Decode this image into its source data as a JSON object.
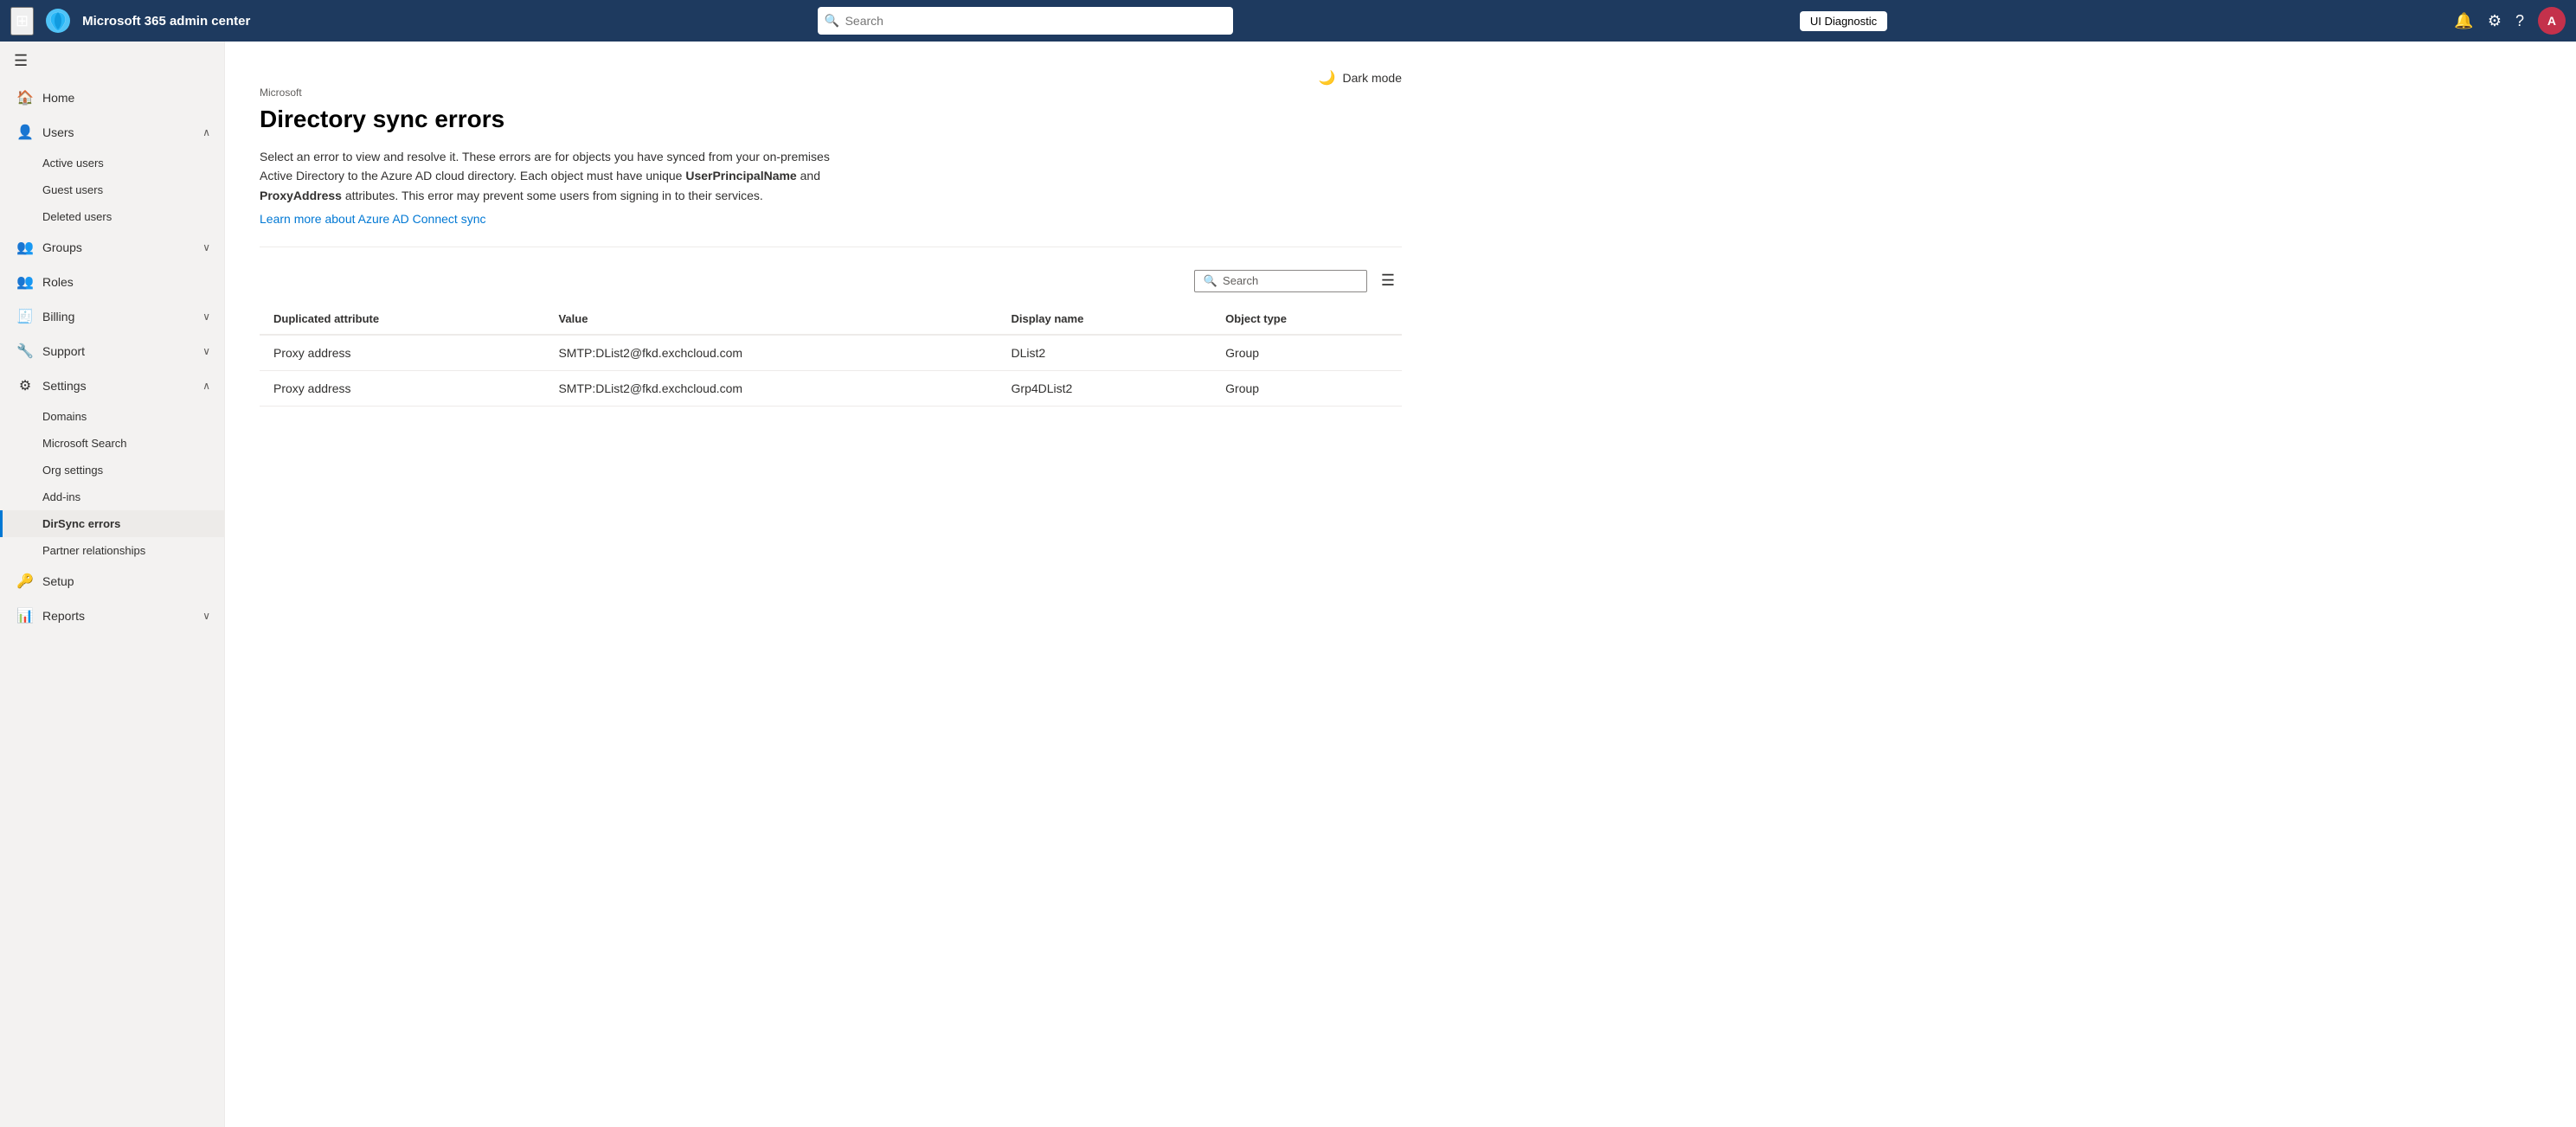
{
  "app": {
    "title": "Microsoft 365 admin center",
    "breadcrumb": "Microsoft",
    "page_title": "Directory sync errors",
    "description_part1": "Select an error to view and resolve it. These errors are for objects you have synced from your on-premises Active Directory to the Azure AD cloud directory. Each object must have unique ",
    "description_bold1": "UserPrincipalName",
    "description_part2": " and ",
    "description_bold2": "ProxyAddress",
    "description_part3": " attributes. This error may prevent some users from signing in to their services.",
    "learn_more_text": "Learn more about Azure AD Connect sync",
    "dark_mode_label": "Dark mode"
  },
  "topnav": {
    "search_placeholder": "Search",
    "ui_diagnostic_label": "UI Diagnostic",
    "avatar_initials": "A",
    "waffle_icon": "⊞",
    "bell_icon": "🔔",
    "gear_icon": "⚙",
    "help_icon": "?"
  },
  "sidebar": {
    "toggle_icon": "☰",
    "items": [
      {
        "id": "home",
        "label": "Home",
        "icon": "🏠",
        "has_children": false
      },
      {
        "id": "users",
        "label": "Users",
        "icon": "👤",
        "has_children": true,
        "expanded": true
      },
      {
        "id": "groups",
        "label": "Groups",
        "icon": "👥",
        "has_children": true,
        "expanded": false
      },
      {
        "id": "roles",
        "label": "Roles",
        "icon": "🔒",
        "has_children": false
      },
      {
        "id": "billing",
        "label": "Billing",
        "icon": "🧾",
        "has_children": true,
        "expanded": false
      },
      {
        "id": "support",
        "label": "Support",
        "icon": "🔧",
        "has_children": true,
        "expanded": false
      },
      {
        "id": "settings",
        "label": "Settings",
        "icon": "⚙",
        "has_children": true,
        "expanded": true
      },
      {
        "id": "setup",
        "label": "Setup",
        "icon": "🔑",
        "has_children": false
      },
      {
        "id": "reports",
        "label": "Reports",
        "icon": "📊",
        "has_children": true,
        "expanded": false
      }
    ],
    "users_children": [
      {
        "id": "active-users",
        "label": "Active users"
      },
      {
        "id": "guest-users",
        "label": "Guest users"
      },
      {
        "id": "deleted-users",
        "label": "Deleted users"
      }
    ],
    "settings_children": [
      {
        "id": "domains",
        "label": "Domains"
      },
      {
        "id": "microsoft-search",
        "label": "Microsoft Search"
      },
      {
        "id": "org-settings",
        "label": "Org settings"
      },
      {
        "id": "add-ins",
        "label": "Add-ins"
      },
      {
        "id": "dirsync-errors",
        "label": "DirSync errors",
        "active": true
      },
      {
        "id": "partner-relationships",
        "label": "Partner relationships"
      }
    ]
  },
  "table": {
    "search_placeholder": "Search",
    "columns": [
      "Duplicated attribute",
      "Value",
      "Display name",
      "Object type"
    ],
    "rows": [
      {
        "duplicated_attribute": "Proxy address",
        "value": "SMTP:DList2@fkd.exchcloud.com",
        "display_name": "DList2",
        "object_type": "Group"
      },
      {
        "duplicated_attribute": "Proxy address",
        "value": "SMTP:DList2@fkd.exchcloud.com",
        "display_name": "Grp4DList2",
        "object_type": "Group"
      }
    ]
  }
}
